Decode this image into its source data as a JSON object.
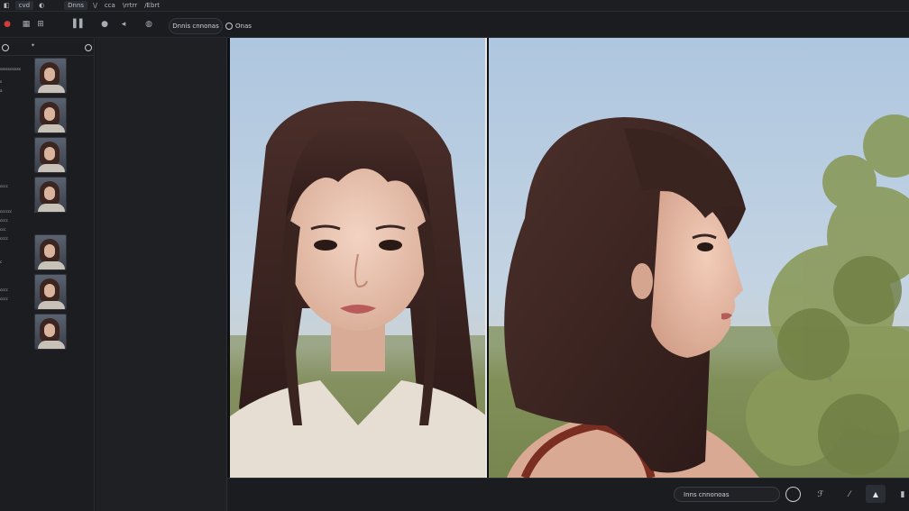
{
  "menubar": {
    "items": [
      {
        "label": "◧",
        "icon": "app-menu-icon"
      },
      {
        "label": "cvd",
        "boxed": true
      },
      {
        "label": "◐",
        "icon": "theme-icon"
      },
      {
        "label": "Dnns",
        "boxed": true
      },
      {
        "label": "\\/",
        "icon": "split-icon"
      },
      {
        "label": "cca",
        "boxed": false
      },
      {
        "label": "\\rrtrr",
        "boxed": false
      },
      {
        "label": "/Ebrt",
        "boxed": false
      }
    ]
  },
  "toolbar": {
    "record_icon": "●",
    "grid_icon": "▦",
    "layout_icon": "⊞",
    "brush_icon": "●",
    "pin_icon": "◂",
    "globe_icon": "◍",
    "mode_pill": "Dnnis cnnonas",
    "mode_pill2": "Onas"
  },
  "left_panel": {
    "rows": [
      "sssssssssss",
      "s",
      "a",
      "",
      "",
      "cccc",
      "cccccc",
      "cccc",
      "ccc",
      "cccc",
      "c",
      "cccc",
      "cccc"
    ],
    "long_label": "sssssssssssss",
    "thumbnails": 7
  },
  "bottom_bar": {
    "label": "Inns cnnonoas",
    "icons": [
      "◯",
      "ℱ",
      "⁄",
      "▲",
      "▮"
    ]
  },
  "colors": {
    "background": "#16181b",
    "panel": "#1b1d21",
    "accent_red": "#d23b3b",
    "divider": "#e8e8e8"
  }
}
